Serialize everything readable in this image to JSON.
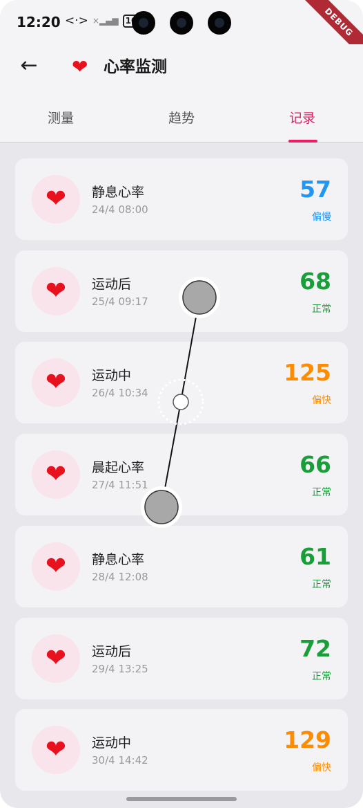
{
  "status_bar": {
    "time": "12:20",
    "network_icon": "<·>",
    "signal_icon": "×▂▄▆",
    "battery": "100"
  },
  "debug_banner": "DEBUG",
  "app_bar": {
    "back_icon": "←",
    "title_icon": "❤",
    "title": "心率监测"
  },
  "tabs": [
    {
      "label": "测量",
      "active": false
    },
    {
      "label": "趋势",
      "active": false
    },
    {
      "label": "记录",
      "active": true
    }
  ],
  "colors": {
    "slow": "#2196f3",
    "normal": "#1a9e3a",
    "fast": "#ff8c00",
    "accent": "#e91e63"
  },
  "records": [
    {
      "type": "静息心率",
      "time": "24/4 08:00",
      "value": "57",
      "status": "偏慢",
      "status_color": "#2196f3",
      "icon": "heart-icon"
    },
    {
      "type": "运动后",
      "time": "25/4 09:17",
      "value": "68",
      "status": "正常",
      "status_color": "#1a9e3a",
      "icon": "heart-icon"
    },
    {
      "type": "运动中",
      "time": "26/4 10:34",
      "value": "125",
      "status": "偏快",
      "status_color": "#ff8c00",
      "icon": "heart-icon"
    },
    {
      "type": "晨起心率",
      "time": "27/4 11:51",
      "value": "66",
      "status": "正常",
      "status_color": "#1a9e3a",
      "icon": "heart-icon"
    },
    {
      "type": "静息心率",
      "time": "28/4 12:08",
      "value": "61",
      "status": "正常",
      "status_color": "#1a9e3a",
      "icon": "heart-icon"
    },
    {
      "type": "运动后",
      "time": "29/4 13:25",
      "value": "72",
      "status": "正常",
      "status_color": "#1a9e3a",
      "icon": "heart-icon"
    },
    {
      "type": "运动中",
      "time": "30/4 14:42",
      "value": "129",
      "status": "偏快",
      "status_color": "#ff8c00",
      "icon": "heart-icon"
    }
  ]
}
